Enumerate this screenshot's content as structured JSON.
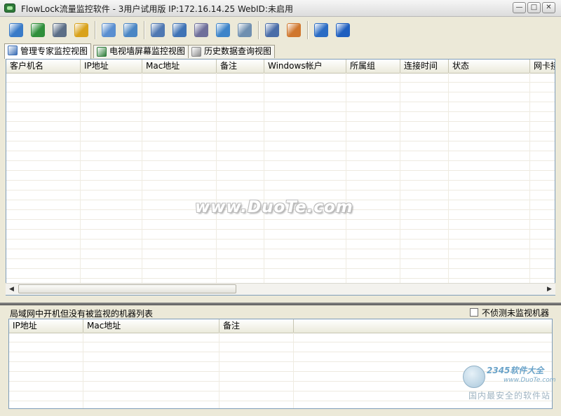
{
  "window": {
    "title": "FlowLock流量监控软件 - 3用户试用版 IP:172.16.14.25 WebID:未启用",
    "controls": [
      "minimize",
      "maximize",
      "close"
    ]
  },
  "toolbar": {
    "groups": [
      [
        {
          "name": "window-stack-icon",
          "color": "#3a7bc8"
        },
        {
          "name": "globe-icon",
          "color": "#2f8f3a"
        },
        {
          "name": "monitor-settings-icon",
          "color": "#5c6e86"
        },
        {
          "name": "users-icon",
          "color": "#d9a21b"
        }
      ],
      [
        {
          "name": "folder-network-icon",
          "color": "#5a8fd0"
        },
        {
          "name": "usb-icon",
          "color": "#4a86c4"
        }
      ],
      [
        {
          "name": "computer-icon",
          "color": "#4f78b2"
        },
        {
          "name": "mail-icon",
          "color": "#3f73b5"
        },
        {
          "name": "document-search-icon",
          "color": "#6f6f9a"
        },
        {
          "name": "copy-windows-icon",
          "color": "#3d84c9"
        },
        {
          "name": "disc-icon",
          "color": "#6f8fb0"
        }
      ],
      [
        {
          "name": "book-icon",
          "color": "#4a6da8"
        },
        {
          "name": "report-icon",
          "color": "#d0772e"
        }
      ],
      [
        {
          "name": "cart-icon",
          "color": "#2b6cc4"
        },
        {
          "name": "help-icon",
          "color": "#1f5fbf"
        }
      ]
    ]
  },
  "tabs": [
    {
      "label": "管理专家监控视图",
      "icon": "magnifier-icon",
      "active": true
    },
    {
      "label": "电视墙屏幕监控视图",
      "icon": "picture-icon",
      "active": false
    },
    {
      "label": "历史数据查询视图",
      "icon": "notepad-icon",
      "active": false
    }
  ],
  "main_table": {
    "columns": [
      "客户机名",
      "IP地址",
      "Mac地址",
      "备注",
      "Windows帐户",
      "所属组",
      "连接时间",
      "状态",
      "网卡接"
    ],
    "rows": []
  },
  "bottom_panel": {
    "title": "局域网中开机但没有被监视的机器列表",
    "checkbox_label": "不侦测未监视机器",
    "checkbox_checked": false,
    "columns": [
      "IP地址",
      "Mac地址",
      "备注"
    ],
    "rows": []
  },
  "watermark": {
    "text": "www.DuoTe.com"
  },
  "logo": {
    "brand": "2345软件大全",
    "url": "www.DuoTe.com",
    "slogan": "国内最安全的软件站"
  }
}
